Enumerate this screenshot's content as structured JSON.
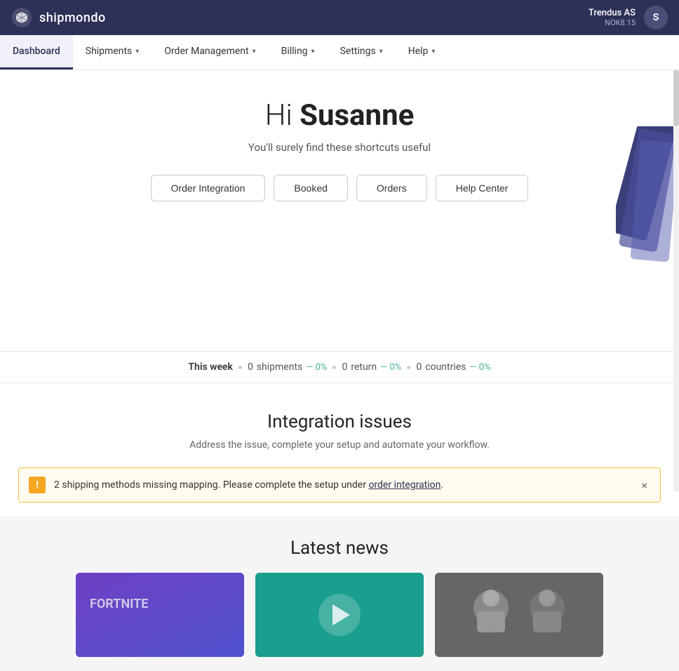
{
  "topbar": {
    "logo_text": "shipmondo",
    "user_name": "Trendus AS",
    "user_balance": "NOK8.15",
    "user_avatar_initial": "S"
  },
  "nav": {
    "items": [
      {
        "label": "Dashboard",
        "active": true,
        "has_dropdown": false
      },
      {
        "label": "Shipments",
        "active": false,
        "has_dropdown": true
      },
      {
        "label": "Order Management",
        "active": false,
        "has_dropdown": true
      },
      {
        "label": "Billing",
        "active": false,
        "has_dropdown": true
      },
      {
        "label": "Settings",
        "active": false,
        "has_dropdown": true
      },
      {
        "label": "Help",
        "active": false,
        "has_dropdown": true
      }
    ]
  },
  "hero": {
    "greeting_prefix": "Hi ",
    "greeting_name": "Susanne",
    "subtitle": "You'll surely find these shortcuts useful",
    "buttons": [
      {
        "label": "Order Integration"
      },
      {
        "label": "Booked"
      },
      {
        "label": "Orders"
      },
      {
        "label": "Help Center"
      }
    ]
  },
  "stats": {
    "period_label": "This week",
    "shipments_count": "0",
    "shipments_label": "shipments",
    "shipments_percent": "— 0%",
    "return_count": "0",
    "return_label": "return",
    "return_percent": "— 0%",
    "countries_count": "0",
    "countries_label": "countries",
    "countries_percent": "— 0%"
  },
  "integration": {
    "title": "Integration issues",
    "subtitle": "Address the issue, complete your setup and automate your workflow.",
    "alert": {
      "icon": "!",
      "text_before": "2 shipping methods missing mapping. Please complete the setup under ",
      "link_text": "order integration",
      "text_after": ".",
      "close_label": "×"
    }
  },
  "latest_news": {
    "title": "Latest news"
  }
}
